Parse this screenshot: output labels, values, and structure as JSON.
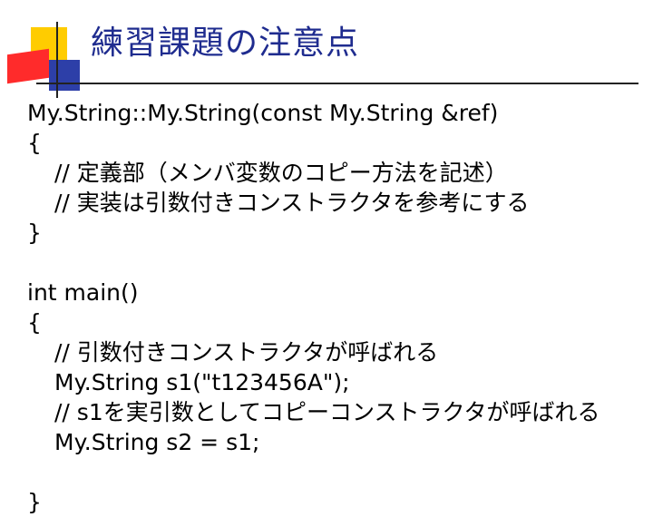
{
  "slide": {
    "title": "練習課題の注意点",
    "lines": [
      "My.String::My.String(const My.String &ref)",
      "{",
      "// 定義部（メンバ変数のコピー方法を記述）",
      "// 実装は引数付きコンストラクタを参考にする",
      "}",
      "",
      "int main()",
      "{",
      "// 引数付きコンストラクタが呼ばれる",
      "My.String s1(\"t123456A\");",
      "// s1を実引数としてコピーコンストラクタが呼ばれる",
      "My.String s2 = s1;",
      "",
      "}"
    ]
  },
  "colors": {
    "title": "#1f2c8f",
    "accent_yellow": "#ffcc00",
    "accent_blue": "#2d3fa8",
    "accent_red": "#ff2b2b"
  }
}
